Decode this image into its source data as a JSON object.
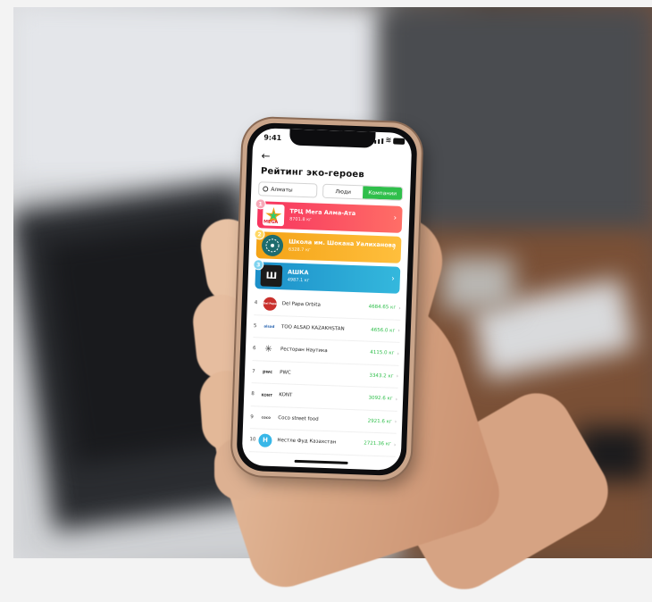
{
  "status_bar": {
    "time": "9:41"
  },
  "header": {
    "back_icon": "arrow-left-icon",
    "title": "Рейтинг эко-героев"
  },
  "filters": {
    "city": "Алматы",
    "segments": [
      "Люди",
      "Компании"
    ],
    "active_segment": "Компании"
  },
  "top_ranks": [
    {
      "rank": "1",
      "name": "ТРЦ Мега Алма-Ата",
      "score": "8701.8 кг",
      "color": "#f7345f",
      "logo_text": "MEGA"
    },
    {
      "rank": "2",
      "name": "Школа им. Шокана Уалиханова",
      "score": "6328.7 кг",
      "color": "#f4a316",
      "logo_text": ""
    },
    {
      "rank": "3",
      "name": "АШКА",
      "score": "4987.1 кг",
      "color": "#1c8fc9",
      "logo_text": "Ш"
    }
  ],
  "list": [
    {
      "rank": "4",
      "name": "Del Papa Orbita",
      "value": "4684.65 кг",
      "avatar_color": "#c9302c",
      "avatar_text": "Del Papa"
    },
    {
      "rank": "5",
      "name": "ТОО ALSAD KAZAKHSTAN",
      "value": "4656.0 кг",
      "avatar_color": "#2b66b1",
      "avatar_text": "alsad"
    },
    {
      "rank": "6",
      "name": "Ресторан Наутика",
      "value": "4115.0 кг",
      "avatar_color": "#444444",
      "avatar_text": "✳"
    },
    {
      "rank": "7",
      "name": "PWC",
      "value": "3343.2 кг",
      "avatar_color": "#e8833a",
      "avatar_text": "pwc"
    },
    {
      "rank": "8",
      "name": "KONT",
      "value": "3092.6 кг",
      "avatar_color": "#555555",
      "avatar_text": "KONT"
    },
    {
      "rank": "9",
      "name": "Coco street food",
      "value": "2921.6 кг",
      "avatar_color": "#666666",
      "avatar_text": "coco"
    },
    {
      "rank": "10",
      "name": "Нестле Фуд Казахстан",
      "value": "2721.36 кг",
      "avatar_color": "#38b7e8",
      "avatar_text": "H"
    }
  ]
}
